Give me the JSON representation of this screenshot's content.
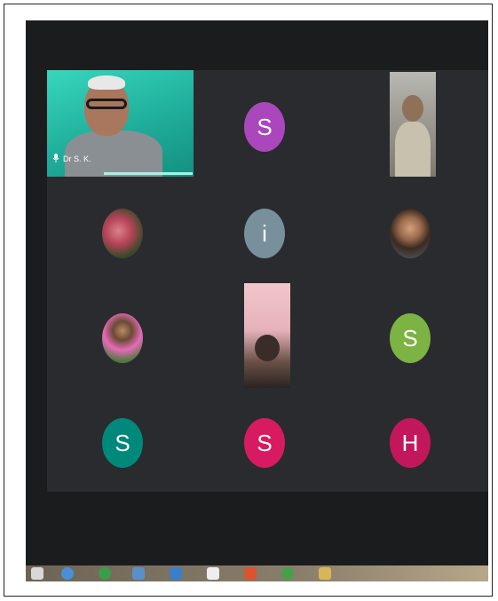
{
  "meeting": {
    "active_speaker_name": "Dr S. K.",
    "participants": [
      {
        "initial": "S",
        "color": "#ab47bc"
      },
      {
        "initial": "i",
        "color": "#78909c"
      },
      {
        "initial": "S",
        "color": "#7cb342"
      },
      {
        "initial": "S",
        "color": "#00897b"
      },
      {
        "initial": "S",
        "color": "#d81b60"
      },
      {
        "initial": "H",
        "color": "#c2185b"
      }
    ]
  },
  "taskbar": {
    "icons": [
      "windows-icon",
      "chrome-icon",
      "green-app-icon",
      "window-icon",
      "blue-app-icon",
      "white-app-icon",
      "red-app-icon",
      "green-circle-icon",
      "folder-icon"
    ]
  }
}
